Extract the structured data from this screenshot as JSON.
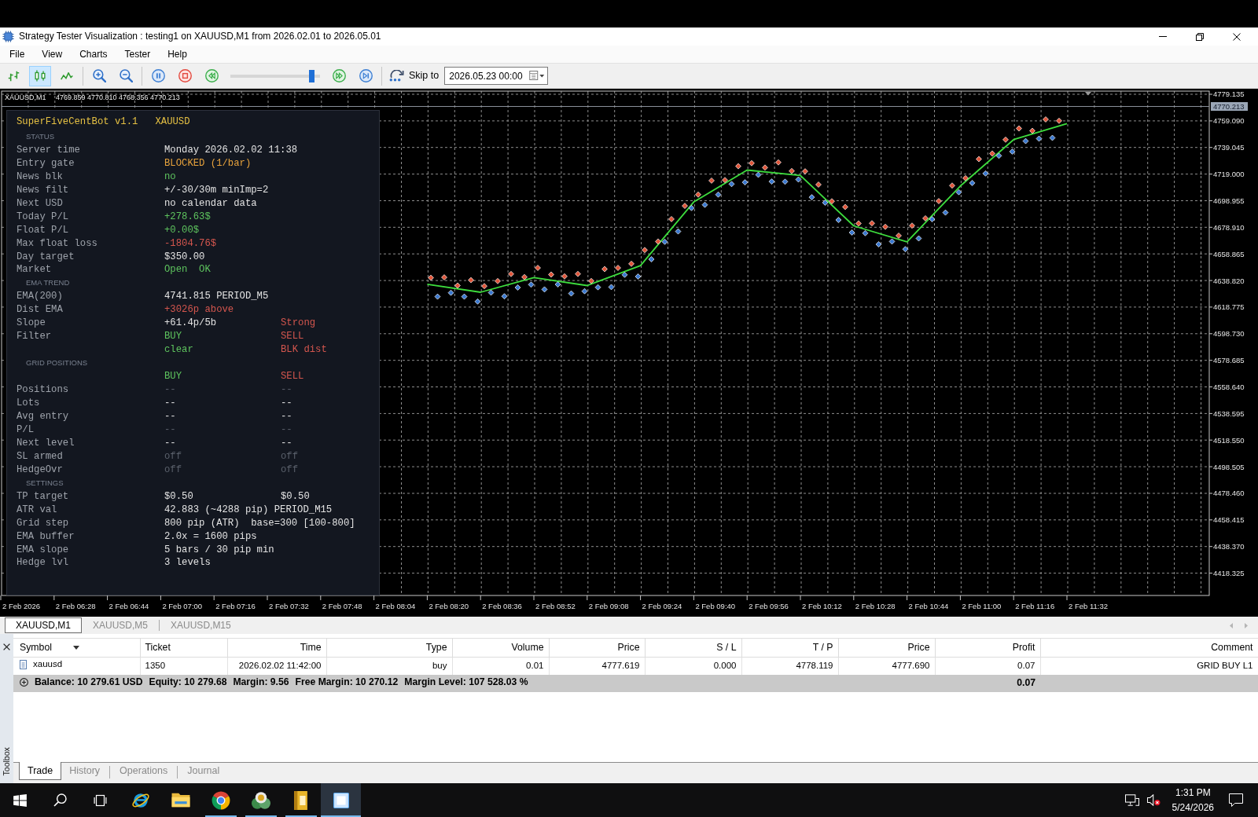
{
  "window": {
    "title": "Strategy Tester Visualization : testing1 on XAUUSD,M1 from 2026.02.01 to 2026.05.01"
  },
  "menu": [
    "File",
    "View",
    "Charts",
    "Tester",
    "Help"
  ],
  "toolbar": {
    "chart_modes": [
      {
        "kind": "bars",
        "selected": false
      },
      {
        "kind": "candles",
        "selected": true
      },
      {
        "kind": "line",
        "selected": false
      }
    ],
    "speed": {
      "level": 0.93
    },
    "skip_to": {
      "label": "Skip to",
      "value": "2026.05.23 00:00"
    }
  },
  "chart": {
    "symbol": "XAUUSD,M1",
    "ohlc": "4769.859 4770.810 4768.356 4770.213",
    "current_price": "4770.213",
    "chart_data": {
      "type": "line",
      "grid": true,
      "categories": [
        "2 Feb 2026",
        "2 Feb 06:28",
        "2 Feb 06:44",
        "2 Feb 07:00",
        "2 Feb 07:16",
        "2 Feb 07:32",
        "2 Feb 07:48",
        "2 Feb 08:04",
        "2 Feb 08:20",
        "2 Feb 08:36",
        "2 Feb 08:52",
        "2 Feb 09:08",
        "2 Feb 09:24",
        "2 Feb 09:40",
        "2 Feb 09:56",
        "2 Feb 10:12",
        "2 Feb 10:28",
        "2 Feb 10:44",
        "2 Feb 11:00",
        "2 Feb 11:16",
        "2 Feb 11:32"
      ],
      "series": [
        {
          "color": "#3ddc3d",
          "values": [
            null,
            null,
            null,
            null,
            null,
            null,
            null,
            null,
            4636,
            4630,
            4641,
            4635,
            4650,
            4698,
            4722,
            4718,
            4680,
            4668,
            4710,
            4745,
            4757
          ]
        }
      ],
      "ylim": [
        4401.5,
        4781.5
      ],
      "yticks": [
        {
          "value": 4779.135,
          "label": "4779.135"
        },
        {
          "value": 4759.09,
          "label": "4759.090"
        },
        {
          "value": 4739.045,
          "label": "4739.045"
        },
        {
          "value": 4719,
          "label": "4719.000"
        },
        {
          "value": 4698.955,
          "label": "4698.955"
        },
        {
          "value": 4678.91,
          "label": "4678.910"
        },
        {
          "value": 4658.865,
          "label": "4658.865"
        },
        {
          "value": 4638.82,
          "label": "4638.820"
        },
        {
          "value": 4618.775,
          "label": "4618.775"
        },
        {
          "value": 4598.73,
          "label": "4598.730"
        },
        {
          "value": 4578.685,
          "label": "4578.685"
        },
        {
          "value": 4558.64,
          "label": "4558.640"
        },
        {
          "value": 4538.595,
          "label": "4538.595"
        },
        {
          "value": 4518.55,
          "label": "4518.550"
        },
        {
          "value": 4498.505,
          "label": "4498.505"
        },
        {
          "value": 4478.46,
          "label": "4478.460"
        },
        {
          "value": 4458.415,
          "label": "4458.415"
        },
        {
          "value": 4438.37,
          "label": "4438.370"
        },
        {
          "value": 4418.325,
          "label": "4418.325"
        }
      ]
    },
    "info_panel": {
      "title": "SuperFiveCentBot v1.1",
      "symbol": "XAUUSD",
      "sections": [
        {
          "heading": "STATUS",
          "rows": [
            {
              "label": "Server time",
              "values": [
                {
                  "text": "Monday 2026.02.02 11:38",
                  "kind": "plain"
                }
              ]
            },
            {
              "label": "Entry gate",
              "values": [
                {
                  "text": "BLOCKED (1/bar)",
                  "kind": "warn"
                }
              ]
            },
            {
              "label": "News blk",
              "values": [
                {
                  "text": "no",
                  "kind": "ok"
                }
              ]
            },
            {
              "label": "News filt",
              "values": [
                {
                  "text": "+/-30/30m minImp=2",
                  "kind": "plain"
                }
              ]
            },
            {
              "label": "Next USD",
              "values": [
                {
                  "text": "no calendar data",
                  "kind": "plain"
                }
              ]
            },
            {
              "label": "Today P/L",
              "values": [
                {
                  "text": "+278.63$",
                  "kind": "ok"
                }
              ]
            },
            {
              "label": "Float P/L",
              "values": [
                {
                  "text": "+0.00$",
                  "kind": "ok"
                }
              ]
            },
            {
              "label": "Max float loss",
              "values": [
                {
                  "text": "-1804.76$",
                  "kind": "bad"
                }
              ]
            },
            {
              "label": "Day target",
              "values": [
                {
                  "text": "$350.00",
                  "kind": "plain"
                }
              ]
            },
            {
              "label": "Market",
              "values": [
                {
                  "text": "Open  OK",
                  "kind": "ok"
                }
              ]
            }
          ]
        },
        {
          "heading": "EMA TREND",
          "rows": [
            {
              "label": "EMA(200)",
              "values": [
                {
                  "text": "4741.815 PERIOD_M5",
                  "kind": "plain"
                }
              ]
            },
            {
              "label": "Dist EMA",
              "values": [
                {
                  "text": "+3026p above",
                  "kind": "bad"
                }
              ]
            },
            {
              "label": "Slope",
              "values": [
                {
                  "text": "+61.4p/5b",
                  "kind": "plain"
                },
                {
                  "text": "Strong",
                  "kind": "bad"
                }
              ]
            },
            {
              "label": "Filter",
              "values": [
                {
                  "text": "BUY",
                  "kind": "ok"
                },
                {
                  "text": "SELL",
                  "kind": "bad"
                }
              ]
            },
            {
              "values": [
                {
                  "text": "clear",
                  "kind": "ok"
                },
                {
                  "text": "BLK dist",
                  "kind": "bad"
                }
              ]
            }
          ]
        },
        {
          "heading": "GRID POSITIONS",
          "rows": [
            {
              "values": [
                {
                  "text": "BUY",
                  "kind": "ok"
                },
                {
                  "text": "SELL",
                  "kind": "bad"
                }
              ]
            },
            {
              "label": "Positions",
              "values": [
                {
                  "text": "--",
                  "kind": "dim"
                },
                {
                  "text": "--",
                  "kind": "dim"
                }
              ]
            },
            {
              "label": "Lots",
              "values": [
                {
                  "text": "--",
                  "kind": "plain"
                },
                {
                  "text": "--",
                  "kind": "plain"
                }
              ]
            },
            {
              "label": "Avg entry",
              "values": [
                {
                  "text": "--",
                  "kind": "plain"
                },
                {
                  "text": "--",
                  "kind": "plain"
                }
              ]
            },
            {
              "label": "P/L",
              "values": [
                {
                  "text": "--",
                  "kind": "dim"
                },
                {
                  "text": "--",
                  "kind": "dim"
                }
              ]
            },
            {
              "label": "Next level",
              "values": [
                {
                  "text": "--",
                  "kind": "plain"
                },
                {
                  "text": "--",
                  "kind": "plain"
                }
              ]
            },
            {
              "label": "SL armed",
              "values": [
                {
                  "text": "off",
                  "kind": "dim"
                },
                {
                  "text": "off",
                  "kind": "dim"
                }
              ]
            },
            {
              "label": "HedgeOvr",
              "values": [
                {
                  "text": "off",
                  "kind": "dim"
                },
                {
                  "text": "off",
                  "kind": "dim"
                }
              ]
            }
          ]
        },
        {
          "heading": "SETTINGS",
          "rows": [
            {
              "label": "TP target",
              "values": [
                {
                  "text": "$0.50",
                  "kind": "plain"
                },
                {
                  "text": "$0.50",
                  "kind": "plain"
                }
              ]
            },
            {
              "label": "ATR val",
              "values": [
                {
                  "text": "42.883 (~4288 pip) PERIOD_M15",
                  "kind": "plain"
                }
              ]
            },
            {
              "label": "Grid step",
              "values": [
                {
                  "text": "800 pip (ATR)  base=300 [100-800]",
                  "kind": "plain"
                }
              ]
            },
            {
              "label": "EMA buffer",
              "values": [
                {
                  "text": "2.0x = 1600 pips",
                  "kind": "plain"
                }
              ]
            },
            {
              "label": "EMA slope",
              "values": [
                {
                  "text": "5 bars / 30 pip min",
                  "kind": "plain"
                }
              ]
            },
            {
              "label": "Hedge lvl",
              "values": [
                {
                  "text": "3 levels",
                  "kind": "plain"
                }
              ]
            }
          ]
        }
      ]
    }
  },
  "chart_tabs": [
    {
      "label": "XAUUSD,M1",
      "selected": true
    },
    {
      "label": "XAUUSD,M5",
      "selected": false
    },
    {
      "label": "XAUUSD,M15",
      "selected": false
    }
  ],
  "toolbox": {
    "title": "Toolbox",
    "columns": [
      {
        "label": "Symbol",
        "sorted": true
      },
      {
        "label": "Ticket",
        "sorted": false
      },
      {
        "label": "Time",
        "sorted": false
      },
      {
        "label": "Type",
        "sorted": false
      },
      {
        "label": "Volume",
        "sorted": false
      },
      {
        "label": "Price",
        "sorted": false
      },
      {
        "label": "S / L",
        "sorted": false
      },
      {
        "label": "T / P",
        "sorted": false
      },
      {
        "label": "Price",
        "sorted": false
      },
      {
        "label": "Profit",
        "sorted": false
      },
      {
        "label": "Comment",
        "sorted": false
      }
    ],
    "rows": [
      {
        "cells": [
          "xauusd",
          "1350",
          "2026.02.02 11:42:00",
          "buy",
          "0.01",
          "4777.619",
          "0.000",
          "4778.119",
          "4777.690",
          "0.07",
          "GRID BUY L1"
        ]
      }
    ],
    "summary": {
      "items": [
        "Balance: 10 279.61 USD",
        "Equity: 10 279.68",
        "Margin: 9.56",
        "Free Margin: 10 270.12",
        "Margin Level: 107 528.03 %"
      ],
      "profit": "0.07"
    },
    "tabs": [
      {
        "label": "Trade",
        "selected": true
      },
      {
        "label": "History",
        "selected": false
      },
      {
        "label": "Operations",
        "selected": false
      },
      {
        "label": "Journal",
        "selected": false
      }
    ]
  },
  "taskbar": {
    "apps": [
      {
        "kind": "ebrowser",
        "running": false,
        "active": false
      },
      {
        "kind": "folder",
        "running": false,
        "active": false
      },
      {
        "kind": "ringbrowser",
        "running": true,
        "active": false
      },
      {
        "kind": "trader",
        "running": true,
        "active": false
      },
      {
        "kind": "notebook",
        "running": true,
        "active": false
      },
      {
        "kind": "chip",
        "running": true,
        "active": true
      }
    ],
    "time": "1:31 PM",
    "date": "5/24/2026"
  }
}
